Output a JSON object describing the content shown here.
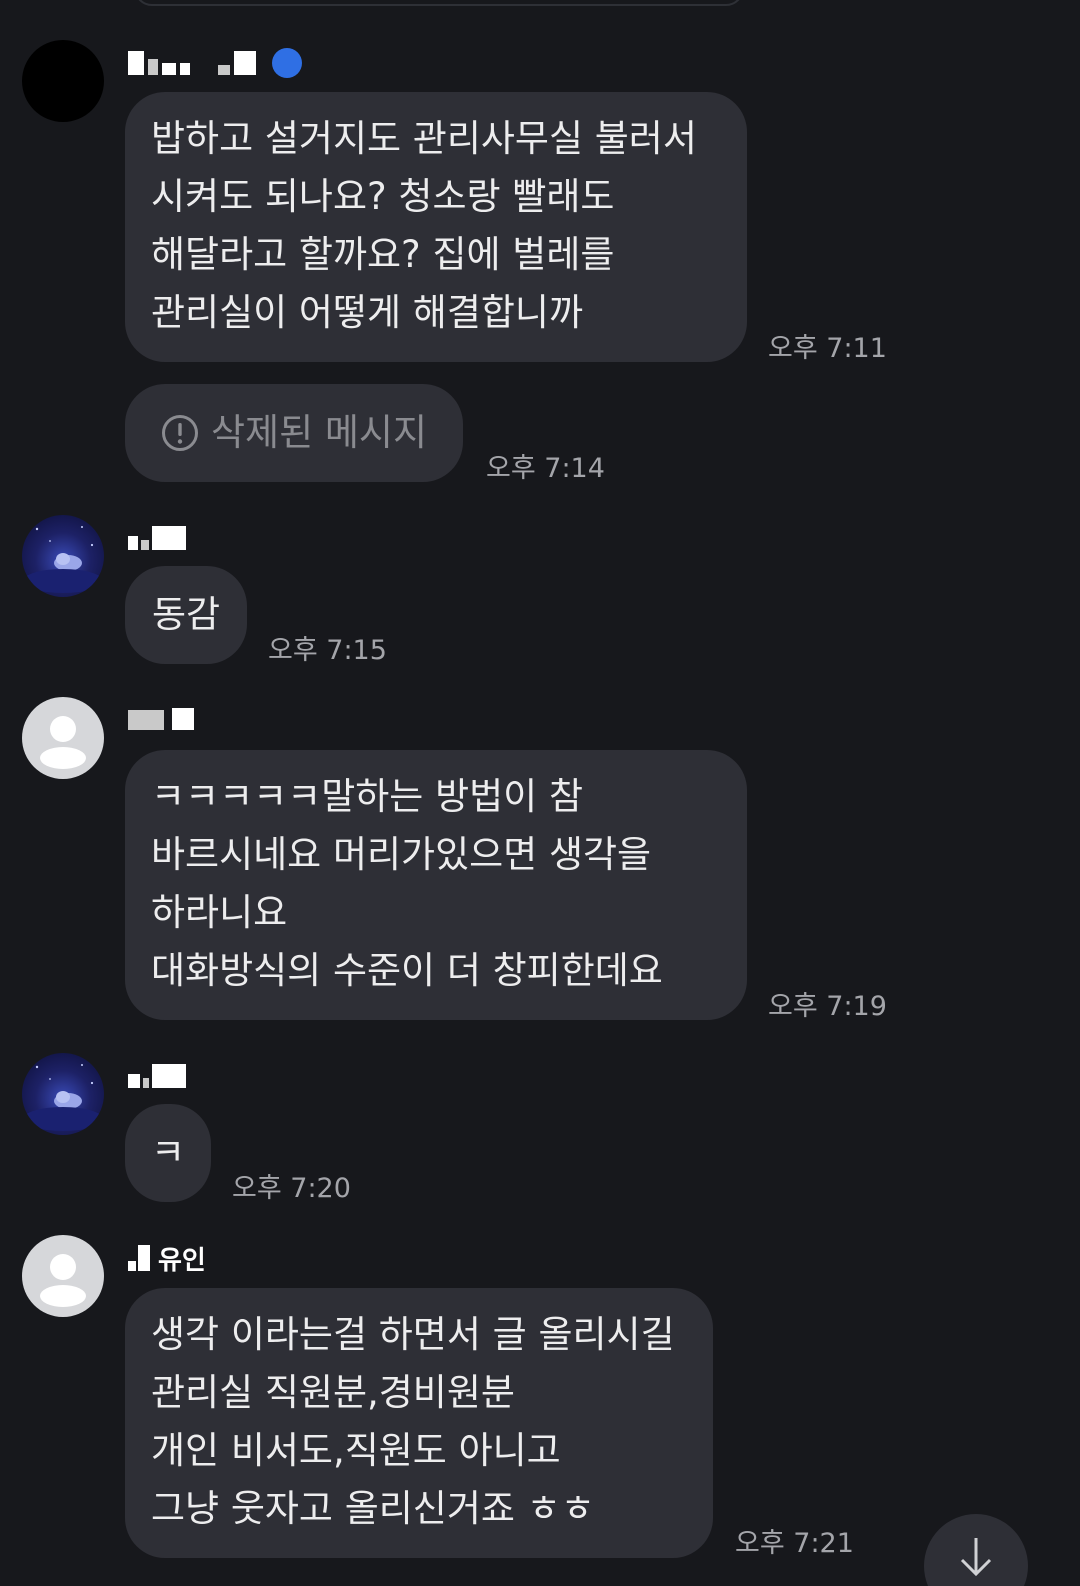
{
  "messages": [
    {
      "sender": "",
      "text": "밥하고 설거지도 관리사무실 불러서\n시켜도 되나요? 청소랑 빨래도\n해달라고 할까요? 집에 벌레를\n관리실이 어떻게 해결합니까",
      "time": "오후 7:11"
    },
    {
      "sender": "",
      "deleted_label": "삭제된 메시지",
      "time": "오후 7:14"
    },
    {
      "sender": "",
      "text": "동감",
      "time": "오후 7:15"
    },
    {
      "sender": "",
      "text": "ㅋㅋㅋㅋㅋ말하는 방법이 참\n바르시네요 머리가있으면 생각을\n하라니요\n대화방식의 수준이 더 창피한데요",
      "time": "오후 7:19"
    },
    {
      "sender": "",
      "text": "ㅋ",
      "time": "오후 7:20"
    },
    {
      "sender": "유인",
      "text": "생각 이라는걸 하면서 글 올리시길\n관리실 직원분,경비원분\n개인 비서도,직원도 아니고\n그냥 웃자고 올리신거죠 ㅎㅎ",
      "time": "오후 7:21"
    }
  ],
  "icons": {
    "deleted": "info-circle-icon",
    "scroll": "arrow-down-icon",
    "verified": "verified-badge-icon"
  },
  "colors": {
    "background": "#17181c",
    "bubble": "#2e2f36",
    "message_text": "#ededee",
    "timestamp": "#a4a5aa",
    "deleted_text": "#8a8b90",
    "verified_badge": "#2f6fe4"
  }
}
